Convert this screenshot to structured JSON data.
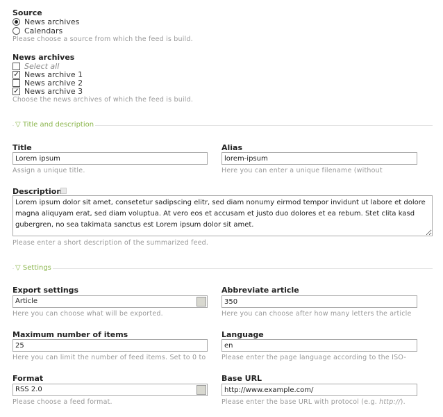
{
  "source": {
    "label": "Source",
    "options": [
      "News archives",
      "Calendars"
    ],
    "help": "Please choose a source from which the feed is build."
  },
  "news_archives": {
    "label": "News archives",
    "select_all": "Select all",
    "items": [
      "News archive 1",
      "News archive 2",
      "News archive 3"
    ],
    "help": "Choose the news archives of which the feed is build."
  },
  "section_title": {
    "legend": "▽ Title and description"
  },
  "title_field": {
    "label": "Title",
    "value": "Lorem ipsum",
    "help": "Assign a unique title."
  },
  "alias_field": {
    "label": "Alias",
    "value": "lorem-ipsum",
    "help": "Here you can enter a unique filename (without"
  },
  "description_field": {
    "label": "Description",
    "value": "Lorem ipsum dolor sit amet, consetetur sadipscing elitr, sed diam nonumy eirmod tempor invidunt ut labore et dolore magna aliquyam erat, sed diam voluptua. At vero eos et accusam et justo duo dolores et ea rebum. Stet clita kasd gubergren, no sea takimata sanctus est Lorem ipsum dolor sit amet.",
    "help": "Please enter a short description of the summarized feed."
  },
  "section_settings": {
    "legend": "▽ Settings"
  },
  "export_settings": {
    "label": "Export settings",
    "value": "Article",
    "help": "Here you can choose what will be exported."
  },
  "abbreviate_article": {
    "label": "Abbreviate article",
    "value": "350",
    "help": "Here you can choose after how many letters the article"
  },
  "max_items": {
    "label": "Maximum number of items",
    "value": "25",
    "help": "Here you can limit the number of feed items. Set to 0 to"
  },
  "language": {
    "label": "Language",
    "value": "en",
    "help": "Please enter the page language according to the ISO-"
  },
  "format": {
    "label": "Format",
    "value": "RSS 2.0",
    "help": "Please choose a feed format."
  },
  "base_url": {
    "label": "Base URL",
    "value": "http://www.example.com/",
    "help": "Please enter the base URL with protocol (e.g.",
    "help_example": "http://",
    "help_end": ")."
  }
}
